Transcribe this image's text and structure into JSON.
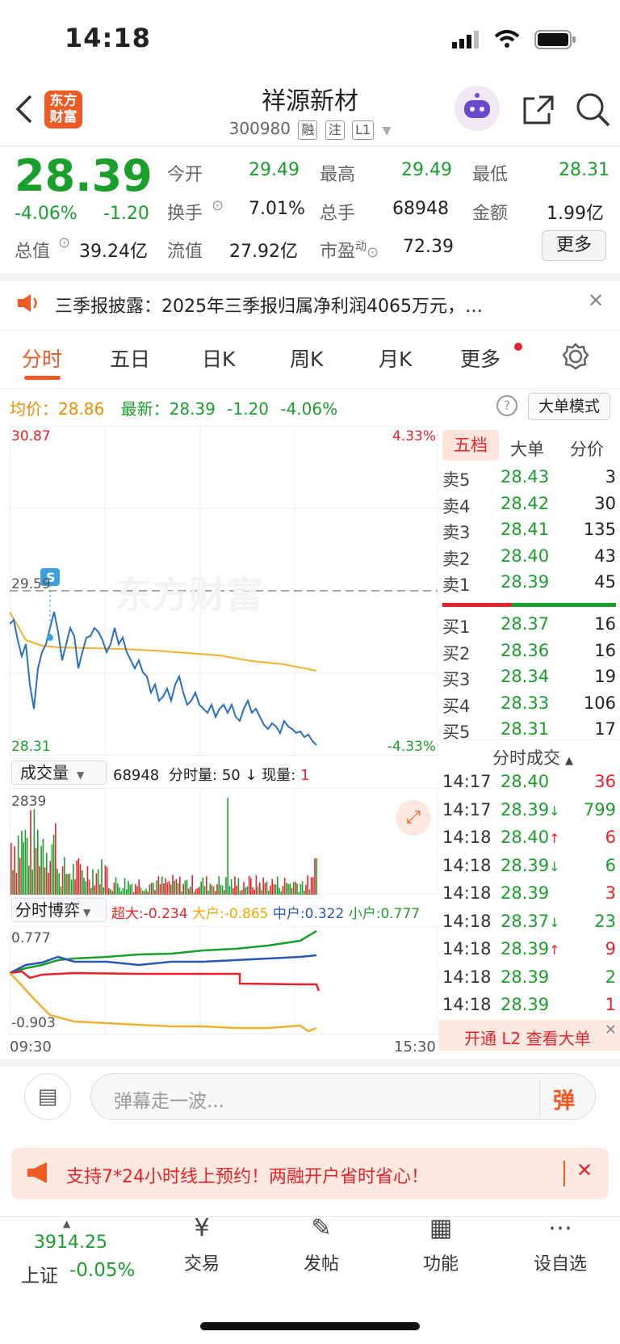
{
  "status_bar": {
    "time": "14:18"
  },
  "header": {
    "back_icon": "chevron-left-icon",
    "logo_text": "东方财富",
    "title": "祥源新材",
    "code": "300980",
    "tags": [
      "融",
      "注",
      "L1"
    ]
  },
  "quote": {
    "price": "28.39",
    "change_pct": "-4.06%",
    "change": "-1.20",
    "fields": {
      "open_label": "今开",
      "open": "29.49",
      "high_label": "最高",
      "high": "29.49",
      "low_label": "最低",
      "low": "28.31",
      "turnover_label": "换手",
      "turnover": "7.01%",
      "volume_label": "总手",
      "volume": "68948",
      "amount_label": "金额",
      "amount": "1.99亿",
      "mktcap_label": "总值",
      "mktcap": "39.24亿",
      "float_label": "流值",
      "float": "27.92亿",
      "pe_label": "市盈",
      "pe_sup": "动",
      "pe": "72.39"
    },
    "more_button": "更多"
  },
  "notice": {
    "text": "三季报披露：2025年三季报归属净利润4065万元，…"
  },
  "tabs": [
    "分时",
    "五日",
    "日K",
    "周K",
    "月K",
    "更多"
  ],
  "info_line": {
    "avg_label": "均价：",
    "avg": "28.86",
    "latest_label": "最新：",
    "latest": "28.39",
    "change": "-1.20",
    "change_pct": "-4.06%",
    "big_order_button": "大单模式"
  },
  "chart_data": {
    "type": "line",
    "y_top": "30.87",
    "y_mid": "29.59",
    "y_bottom": "28.31",
    "pct_top": "4.33%",
    "pct_bottom": "-4.33%",
    "watermark": "东方财富",
    "marker_label": "S",
    "x_start": "09:30",
    "x_end": "15:30"
  },
  "volume_panel": {
    "selector": "成交量",
    "total": "68948",
    "min_vol_label": "分时量:",
    "min_vol": "50",
    "now_label": "现量:",
    "now": "1",
    "max": "2839"
  },
  "game_panel": {
    "selector": "分时博弈",
    "items": [
      {
        "label": "超大:",
        "value": "-0.234",
        "color": "#e8232b"
      },
      {
        "label": "大户:",
        "value": "-0.865",
        "color": "#f0a800"
      },
      {
        "label": "中户:",
        "value": "0.322",
        "color": "#2a56b5"
      },
      {
        "label": "小户:",
        "value": "0.777",
        "color": "#1a9e2c"
      }
    ],
    "y_top": "0.777",
    "y_bottom": "-0.903"
  },
  "order_book": {
    "tabs": [
      "五档",
      "大单",
      "分价"
    ],
    "asks": [
      {
        "label": "卖5",
        "price": "28.43",
        "vol": "3"
      },
      {
        "label": "卖4",
        "price": "28.42",
        "vol": "30"
      },
      {
        "label": "卖3",
        "price": "28.41",
        "vol": "135"
      },
      {
        "label": "卖2",
        "price": "28.40",
        "vol": "43"
      },
      {
        "label": "卖1",
        "price": "28.39",
        "vol": "45"
      }
    ],
    "bids": [
      {
        "label": "买1",
        "price": "28.37",
        "vol": "16"
      },
      {
        "label": "买2",
        "price": "28.36",
        "vol": "16"
      },
      {
        "label": "买3",
        "price": "28.34",
        "vol": "19"
      },
      {
        "label": "买4",
        "price": "28.33",
        "vol": "106"
      },
      {
        "label": "买5",
        "price": "28.31",
        "vol": "17"
      }
    ]
  },
  "trades": {
    "title": "分时成交",
    "rows": [
      {
        "time": "14:17",
        "price": "28.40",
        "arrow": "",
        "vol": "36",
        "color": "#e8232b"
      },
      {
        "time": "14:17",
        "price": "28.39",
        "arrow": "↓",
        "vol": "799",
        "color": "#1a9e2c"
      },
      {
        "time": "14:18",
        "price": "28.40",
        "arrow": "↑",
        "vol": "6",
        "color": "#e8232b"
      },
      {
        "time": "14:18",
        "price": "28.39",
        "arrow": "↓",
        "vol": "6",
        "color": "#1a9e2c"
      },
      {
        "time": "14:18",
        "price": "28.39",
        "arrow": "",
        "vol": "3",
        "color": "#e8232b"
      },
      {
        "time": "14:18",
        "price": "28.37",
        "arrow": "↓",
        "vol": "23",
        "color": "#1a9e2c"
      },
      {
        "time": "14:18",
        "price": "28.39",
        "arrow": "↑",
        "vol": "9",
        "color": "#e8232b"
      },
      {
        "time": "14:18",
        "price": "28.39",
        "arrow": "",
        "vol": "2",
        "color": "#1a9e2c"
      },
      {
        "time": "14:18",
        "price": "28.39",
        "arrow": "",
        "vol": "1",
        "color": "#e8232b"
      }
    ],
    "l2_banner": "开通 L2 查看大单"
  },
  "danmaku": {
    "placeholder": "弹幕走一波...",
    "send_label": "弹"
  },
  "promo": {
    "text": "支持7*24小时线上预约！两融开户省时省心！"
  },
  "bottom_nav": {
    "index_value": "3914.25",
    "index_name": "上证",
    "index_change": "-0.05%",
    "items": [
      {
        "label": "交易",
        "icon": "yen-cycle-icon"
      },
      {
        "label": "发帖",
        "icon": "edit-icon"
      },
      {
        "label": "功能",
        "icon": "grid-icon"
      },
      {
        "label": "设自选",
        "icon": "more-icon"
      }
    ]
  }
}
